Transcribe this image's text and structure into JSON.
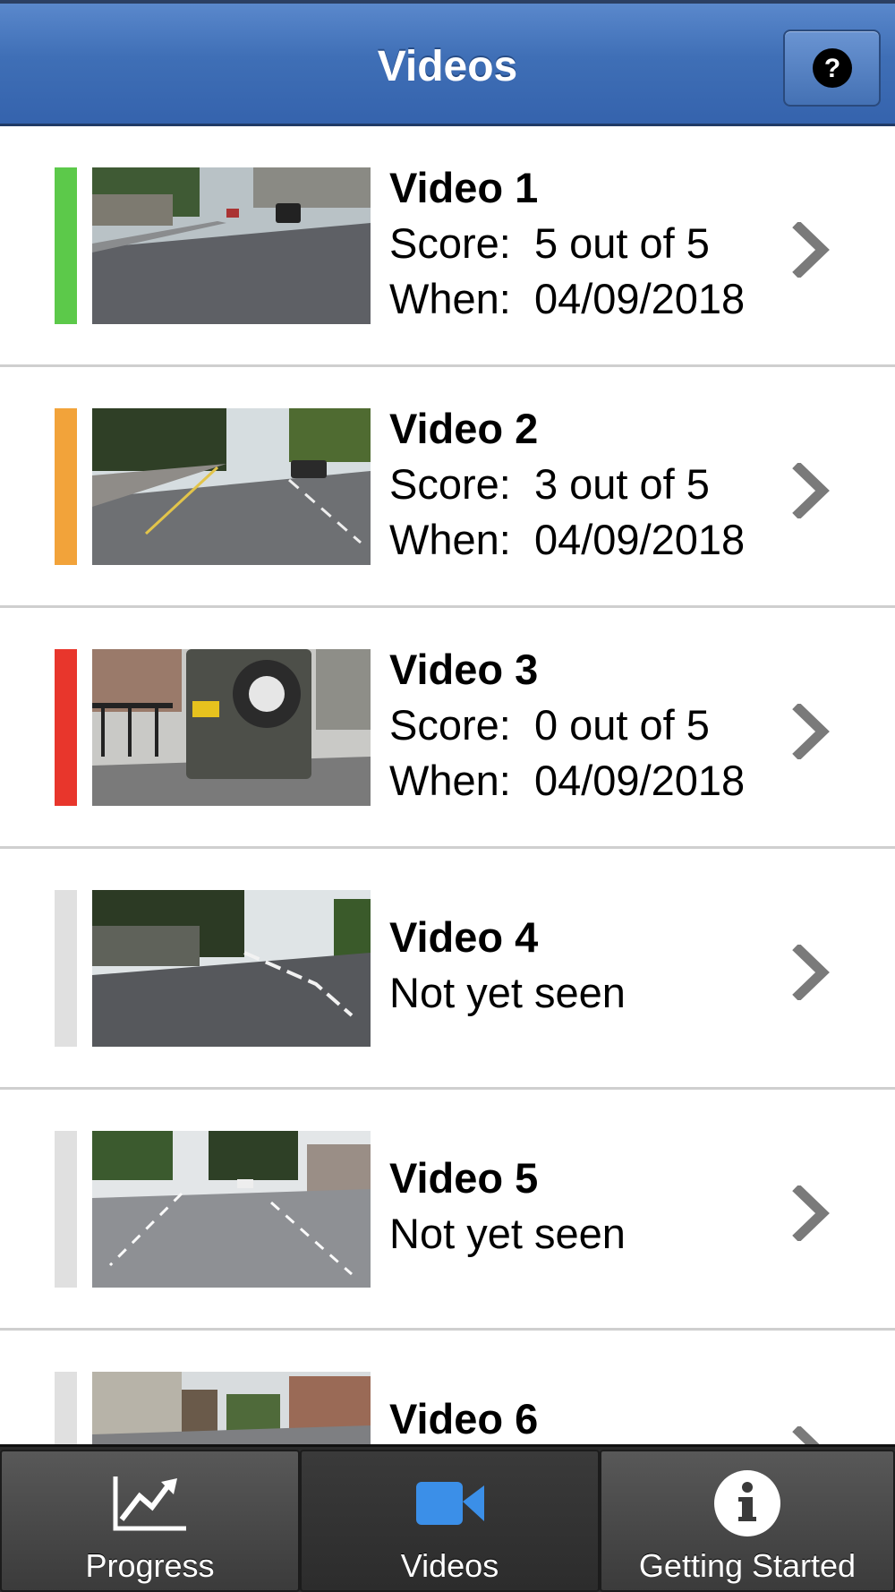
{
  "header": {
    "title": "Videos",
    "help_icon": "question-circle-icon"
  },
  "videos": [
    {
      "title": "Video 1",
      "line1": "Score:  5 out of 5",
      "line2": "When:  04/09/2018",
      "status_color": "#5cc94a"
    },
    {
      "title": "Video 2",
      "line1": "Score:  3 out of 5",
      "line2": "When:  04/09/2018",
      "status_color": "#f2a33a"
    },
    {
      "title": "Video 3",
      "line1": "Score:  0 out of 5",
      "line2": "When:  04/09/2018",
      "status_color": "#e8362c"
    },
    {
      "title": "Video 4",
      "line1": "Not yet seen",
      "status_color": "#e0e0e0"
    },
    {
      "title": "Video 5",
      "line1": "Not yet seen",
      "status_color": "#e0e0e0"
    },
    {
      "title": "Video 6",
      "status_color": "#e0e0e0"
    }
  ],
  "tabbar": {
    "tabs": [
      {
        "label": "Progress",
        "icon": "chart-line-icon",
        "active": false
      },
      {
        "label": "Videos",
        "icon": "video-camera-icon",
        "active": true
      },
      {
        "label": "Getting Started",
        "icon": "info-icon",
        "active": false
      }
    ]
  },
  "colors": {
    "header_blue": "#3f6fb6",
    "active_tab_icon": "#3b8fe8",
    "chevron": "#7a7a7a"
  }
}
